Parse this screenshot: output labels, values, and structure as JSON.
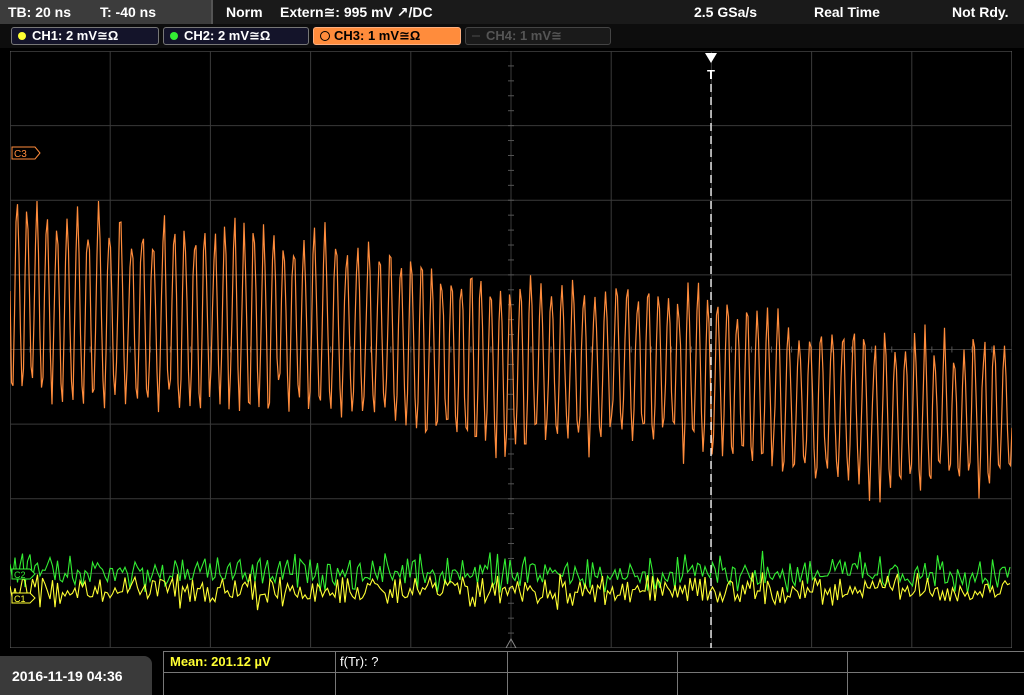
{
  "status": {
    "timebase": "TB: 20 ns",
    "trigger_time": "T: -40 ns",
    "trigger_mode": "Norm",
    "trigger_source": "Extern≅: 995 mV ↗/DC",
    "sample_rate": "2.5 GSa/s",
    "acq_mode": "Real Time",
    "state": "Not Rdy."
  },
  "channels": [
    {
      "label": "CH1: 2 mV≅Ω",
      "color": "#ffff33",
      "active": true
    },
    {
      "label": "CH2: 2 mV≅Ω",
      "color": "#33ee33",
      "active": true
    },
    {
      "label": "CH3: 1 mV≅Ω",
      "color": "#ff8c3c",
      "active": true,
      "selected": true
    },
    {
      "label": "CH4: 1 mV≅",
      "color": "#555555",
      "active": false
    }
  ],
  "markers": {
    "c3": "C3",
    "c2": "C2",
    "c1": "C1",
    "trigger": "T"
  },
  "measurements": {
    "mean": "Mean: 201.12 µV",
    "ftr": "f(Tr): ?"
  },
  "datetime": "2016-11-19 04:36",
  "colors": {
    "ch1": "#ffff33",
    "ch2": "#33ee33",
    "ch3": "#ff8c3c",
    "grid": "#3a3a3a"
  }
}
